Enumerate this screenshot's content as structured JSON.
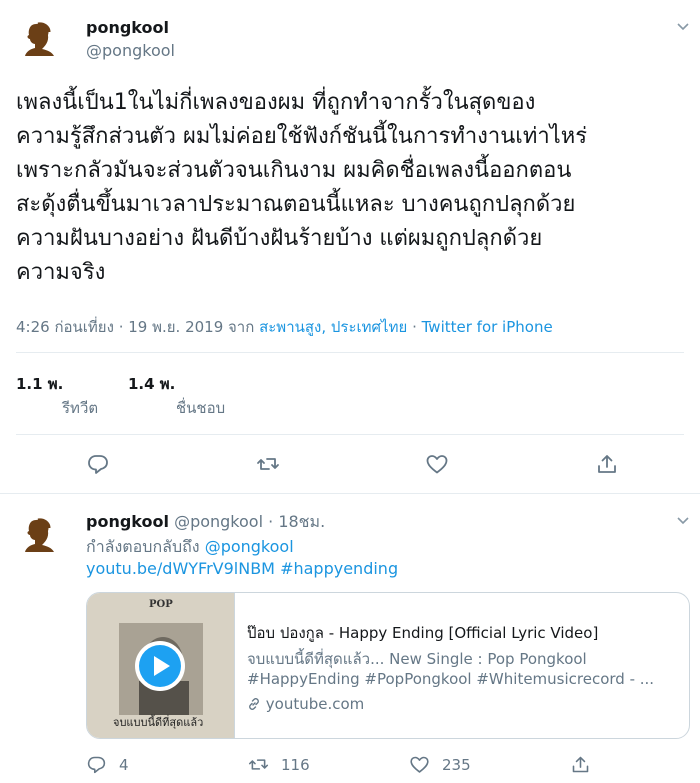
{
  "main_tweet": {
    "display_name": "pongkool",
    "handle": "@pongkool",
    "text_lines": [
      "เพลงนี้เป็น1ในไม่กี่เพลงของผม ที่ถูกทำจากรั้วในสุดของ",
      "ความรู้สึกส่วนตัว ผมไม่ค่อยใช้ฟังก์ชันนี้ในการทำงานเท่าไหร่",
      "เพราะกลัวมันจะส่วนตัวจนเกินงาม ผมคิดชื่อเพลงนี้ออกตอน",
      "สะดุ้งตื่นขึ้นมาเวลาประมาณตอนนี้แหละ บางคนถูกปลุกด้วย",
      "ความฝันบางอย่าง ฝันดีบ้างฝันร้ายบ้าง แต่ผมถูกปลุกด้วย",
      "ความจริง"
    ],
    "timestamp": "4:26 ก่อนเที่ยง · 19 พ.ย. 2019 จาก",
    "location": "สะพานสูง, ประเทศไทย",
    "separator": "·",
    "source": "Twitter for iPhone",
    "retweets_count": "1.1 พ.",
    "retweets_label": "รีทวีต",
    "likes_count": "1.4 พ.",
    "likes_label": "ชื่นชอบ"
  },
  "reply_tweet": {
    "display_name": "pongkool",
    "handle": "@pongkool",
    "dot": "·",
    "time": "18ชม.",
    "replying_prefix": "กำลังตอบกลับถึง",
    "replying_to": "@pongkool",
    "link_text": "youtu.be/dWYFrV9lNBM",
    "hashtag": "#happyending",
    "card": {
      "title": "ป๊อบ ปองกูล - Happy Ending [Official Lyric Video]",
      "desc_line1": "จบแบบนี้ดีที่สุดแล้ว... New Single : Pop Pongkool",
      "desc_line2": "#HappyEnding #PopPongkool #Whitemusicrecord - ...",
      "domain": "youtube.com",
      "thumb_top_text": "POP",
      "thumb_caption": "จบแบบนี้ดีที่สุดแล้ว"
    },
    "reply_count": "4",
    "retweet_count": "116",
    "like_count": "235"
  },
  "colors": {
    "link": "#1b95e0",
    "secondary_text": "#657786",
    "divider": "#e6ecf0",
    "play_button": "#1da1f2"
  },
  "icons": [
    "silhouette-avatar-icon",
    "chevron-down-icon",
    "reply-icon",
    "retweet-icon",
    "like-icon",
    "share-icon",
    "play-icon",
    "link-icon"
  ]
}
